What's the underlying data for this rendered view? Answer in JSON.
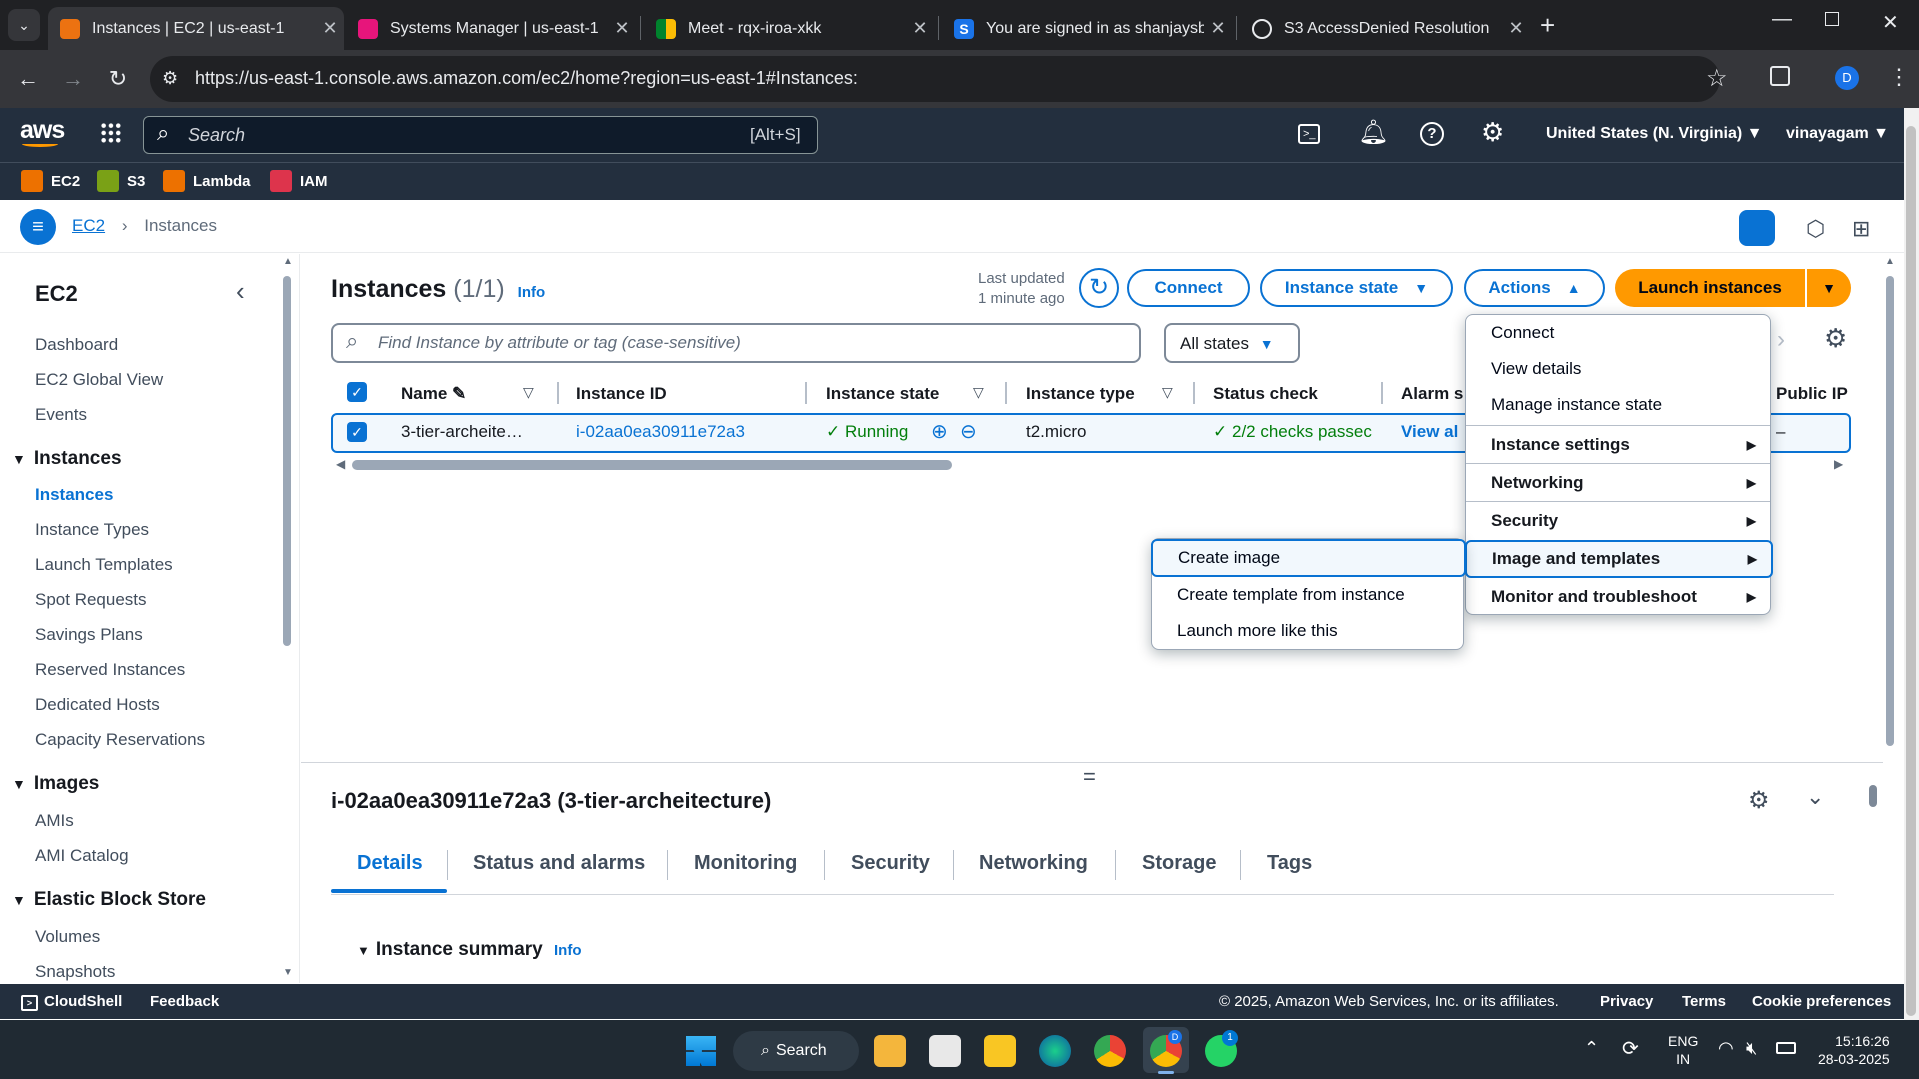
{
  "browser": {
    "tabs": [
      {
        "title": "Instances | EC2 | us-east-1",
        "active": true
      },
      {
        "title": "Systems Manager | us-east-1",
        "active": false
      },
      {
        "title": "Meet - rqx-iroa-xkk",
        "active": false
      },
      {
        "title": "You are signed in as shanjaysb",
        "active": false
      },
      {
        "title": "S3 AccessDenied Resolution",
        "active": false
      }
    ],
    "url": "https://us-east-1.console.aws.amazon.com/ec2/home?region=us-east-1#Instances:",
    "profile_initial": "D"
  },
  "aws_header": {
    "logo": "aws",
    "search_placeholder": "Search",
    "search_shortcut": "[Alt+S]",
    "region": "United States (N. Virginia)",
    "account": "vinayagam",
    "favorites": [
      "EC2",
      "S3",
      "Lambda",
      "IAM"
    ]
  },
  "breadcrumb": {
    "service": "EC2",
    "page": "Instances"
  },
  "sidebar": {
    "title": "EC2",
    "top_items": [
      "Dashboard",
      "EC2 Global View",
      "Events"
    ],
    "sections": [
      {
        "title": "Instances",
        "items": [
          "Instances",
          "Instance Types",
          "Launch Templates",
          "Spot Requests",
          "Savings Plans",
          "Reserved Instances",
          "Dedicated Hosts",
          "Capacity Reservations"
        ]
      },
      {
        "title": "Images",
        "items": [
          "AMIs",
          "AMI Catalog"
        ]
      },
      {
        "title": "Elastic Block Store",
        "items": [
          "Volumes",
          "Snapshots"
        ]
      }
    ],
    "active_item": "Instances"
  },
  "instances": {
    "title": "Instances",
    "count": "(1/1)",
    "info": "Info",
    "last_updated_line1": "Last updated",
    "last_updated_line2": "1 minute ago",
    "connect_label": "Connect",
    "instance_state_label": "Instance state",
    "actions_label": "Actions",
    "launch_label": "Launch instances",
    "filter_placeholder": "Find Instance by attribute or tag (case-sensitive)",
    "states_filter": "All states",
    "columns": [
      "Name",
      "Instance ID",
      "Instance state",
      "Instance type",
      "Status check",
      "Alarm s",
      "Public IP"
    ],
    "row": {
      "name": "3-tier-archeite…",
      "instance_id": "i-02aa0ea30911e72a3",
      "state": "Running",
      "type": "t2.micro",
      "status_check": "2/2 checks passec",
      "alarm": "View al",
      "public_ip": "–"
    }
  },
  "actions_menu": {
    "items": [
      "Connect",
      "View details",
      "Manage instance state"
    ],
    "submenus": [
      "Instance settings",
      "Networking",
      "Security",
      "Image and templates",
      "Monitor and troubleshoot"
    ],
    "highlighted": "Image and templates"
  },
  "image_submenu": {
    "items": [
      "Create image",
      "Create template from instance",
      "Launch more like this"
    ]
  },
  "details": {
    "title": "i-02aa0ea30911e72a3 (3-tier-archeitecture)",
    "tabs": [
      "Details",
      "Status and alarms",
      "Monitoring",
      "Security",
      "Networking",
      "Storage",
      "Tags"
    ],
    "active_tab": "Details",
    "section": "Instance summary",
    "section_info": "Info"
  },
  "footer": {
    "cloudshell": "CloudShell",
    "feedback": "Feedback",
    "copyright": "© 2025, Amazon Web Services, Inc. or its affiliates.",
    "links": [
      "Privacy",
      "Terms",
      "Cookie preferences"
    ]
  },
  "taskbar": {
    "search": "Search",
    "lang_line1": "ENG",
    "lang_line2": "IN",
    "time": "15:16:26",
    "date": "28-03-2025",
    "badge_chrome": "D",
    "badge_whatsapp": "1"
  },
  "colors": {
    "aws_dark": "#232f3e",
    "link_blue": "#0972d3",
    "launch_orange": "#ff9900",
    "running_green": "#037f0c"
  }
}
